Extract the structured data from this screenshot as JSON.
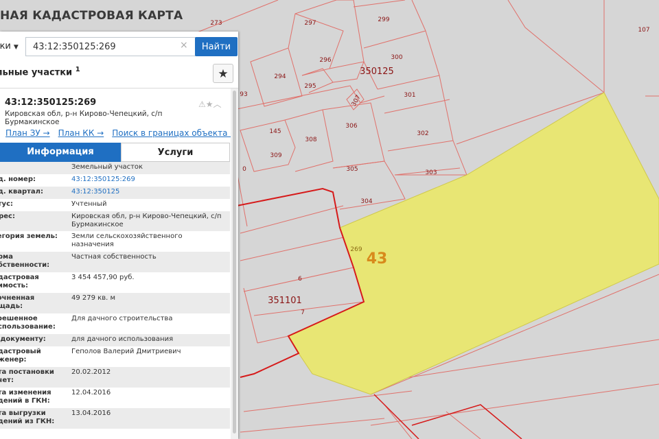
{
  "app": {
    "title": "НАЯ КАДАСТРОВАЯ КАРТА"
  },
  "search": {
    "type_label": "тки",
    "value": "43:12:350125:269",
    "button_label": "Найти"
  },
  "section": {
    "title": "льные участки",
    "count_sup": "1"
  },
  "result": {
    "number": "43:12:350125:269",
    "address": "Кировская обл, р-н Кирово-Чепецкий, с/п Бурмакинское",
    "links": [
      "План ЗУ →",
      "План КК →",
      "Поиск в границах объекта →"
    ]
  },
  "tabs": {
    "info": "Информация",
    "services": "Услуги"
  },
  "info_rows": [
    {
      "key": [
        "п:"
      ],
      "value": "Земельный участок"
    },
    {
      "key": [
        "ад. номер:"
      ],
      "value": "43:12:350125:269"
    },
    {
      "key": [
        "ад. квартал:"
      ],
      "value": "43:12:350125"
    },
    {
      "key": [
        "атус:"
      ],
      "value": "Учтенный"
    },
    {
      "key": [
        "дрес:"
      ],
      "value": "Кировская обл, р-н Кирово-Чепецкий, с/п Бурмакинское"
    },
    {
      "key": [
        "тегория земель:"
      ],
      "value": "Земли сельскохозяйственного назначения"
    },
    {
      "key": [
        "орма",
        "обственности:"
      ],
      "value": "Частная собственность"
    },
    {
      "key": [
        "адастровая",
        "оимость:"
      ],
      "value": "3 454 457,90 руб."
    },
    {
      "key": [
        "точненная",
        "ощадь:"
      ],
      "value": "49 279 кв. м"
    },
    {
      "key": [
        "зрешенное",
        "использование:"
      ],
      "value": "Для дачного строительства"
    },
    {
      "key": [
        "о документу:"
      ],
      "value": "для дачного использования"
    },
    {
      "key": [
        "адастровый",
        "нженер:"
      ],
      "value": "Геполов Валерий Дмитриевич"
    },
    {
      "key": [
        "ата постановки",
        "учет:"
      ],
      "value": "20.02.2012"
    },
    {
      "key": [
        "ата изменения",
        "едений в ГКН:"
      ],
      "value": "12.04.2016"
    },
    {
      "key": [
        "ата выгрузки",
        "едений из ГКН:"
      ],
      "value": "13.04.2016"
    }
  ],
  "map": {
    "selected_parcel_label": "269",
    "selected_parcel_quarter_badge": "43",
    "quarter_labels": [
      "350125",
      "351101"
    ],
    "parcel_labels": [
      "273",
      "297",
      "299",
      "107",
      "296",
      "300",
      "294",
      "295",
      "93",
      "307",
      "301",
      "145",
      "306",
      "302",
      "309",
      "308",
      "303",
      "305",
      "304",
      "6",
      "7",
      "0"
    ],
    "colors": {
      "selection_fill": "#e8e674",
      "parcel_border": "#e0706a",
      "quarter_border": "#d61a1a",
      "background": "#d6d6d6"
    }
  }
}
